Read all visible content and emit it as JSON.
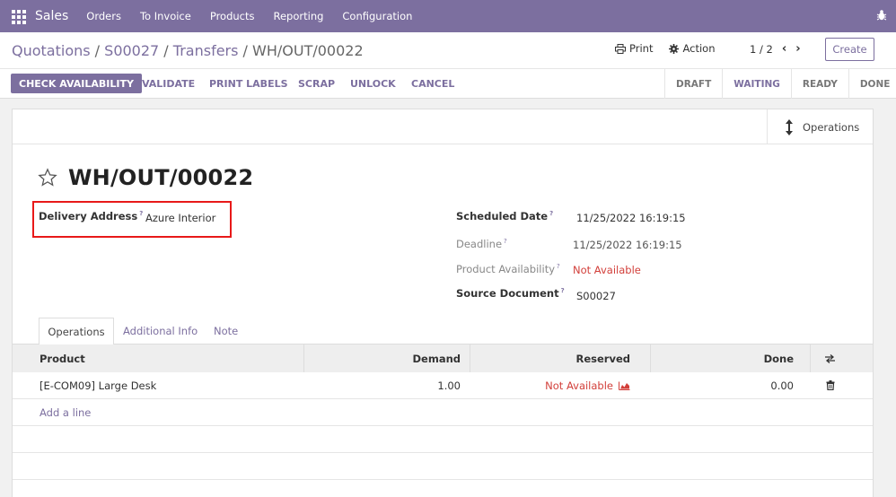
{
  "navbar": {
    "brand": "Sales",
    "menus": [
      "Orders",
      "To Invoice",
      "Products",
      "Reporting",
      "Configuration"
    ]
  },
  "breadcrumb": {
    "items": [
      "Quotations",
      "S00027",
      "Transfers"
    ],
    "separator": " / ",
    "current": "WH/OUT/00022"
  },
  "toolbar": {
    "print_label": "Print",
    "action_label": "Action",
    "pager": "1 / 2",
    "create_label": "Create"
  },
  "statusbar": {
    "buttons": [
      "CHECK AVAILABILITY",
      "VALIDATE",
      "PRINT LABELS",
      "SCRAP",
      "UNLOCK",
      "CANCEL"
    ],
    "states": [
      "DRAFT",
      "WAITING",
      "READY",
      "DONE"
    ],
    "active_state": "WAITING"
  },
  "smart_button": {
    "label": "Operations"
  },
  "record": {
    "title": "WH/OUT/00022",
    "delivery_address_label": "Delivery Address",
    "delivery_address": "Azure Interior",
    "scheduled_date_label": "Scheduled Date",
    "scheduled_date": "11/25/2022 16:19:15",
    "deadline_label": "Deadline",
    "deadline": "11/25/2022 16:19:15",
    "availability_label": "Product Availability",
    "availability": "Not Available",
    "source_label": "Source Document",
    "source": "S00027",
    "help_mark": "?"
  },
  "tabs": [
    "Operations",
    "Additional Info",
    "Note"
  ],
  "table": {
    "headers": [
      "Product",
      "Demand",
      "Reserved",
      "Done"
    ],
    "rows": [
      {
        "product": "[E-COM09] Large Desk",
        "demand": "1.00",
        "reserved": "Not Available",
        "done": "0.00"
      }
    ],
    "add_line": "Add a line"
  },
  "colors": {
    "brand": "#7c6f9f",
    "alert": "#d23f3a",
    "highlight": "#e81919"
  }
}
